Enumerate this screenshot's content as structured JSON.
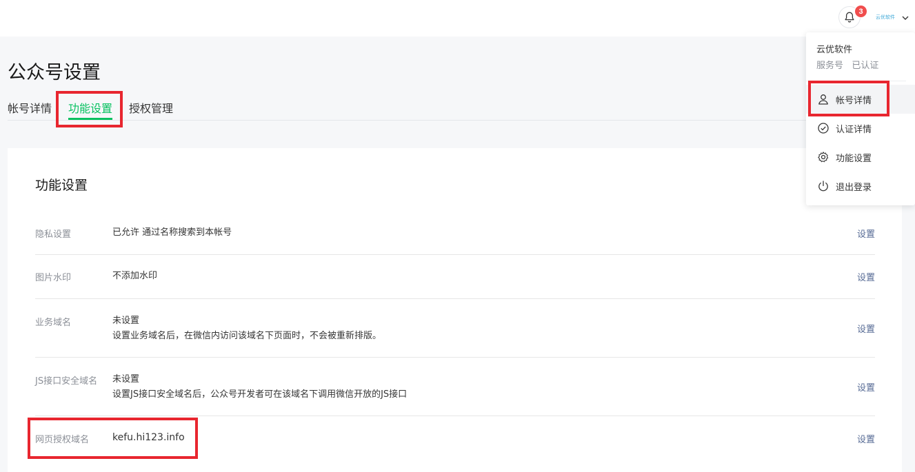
{
  "header": {
    "notification_count": "3",
    "brand_logo_text": "云优软件"
  },
  "page": {
    "title": "公众号设置",
    "tabs": [
      {
        "label": "帐号详情"
      },
      {
        "label": "功能设置"
      },
      {
        "label": "授权管理"
      }
    ]
  },
  "card": {
    "title": "功能设置",
    "rows": [
      {
        "label": "隐私设置",
        "value": "已允许 通过名称搜索到本帐号",
        "value2": "",
        "action": "设置"
      },
      {
        "label": "图片水印",
        "value": "不添加水印",
        "value2": "",
        "action": "设置"
      },
      {
        "label": "业务域名",
        "value": "未设置",
        "value2": "设置业务域名后，在微信内访问该域名下页面时，不会被重新排版。",
        "action": "设置"
      },
      {
        "label": "JS接口安全域名",
        "value": "未设置",
        "value2": "设置JS接口安全域名后，公众号开发者可在该域名下调用微信开放的JS接口",
        "action": "设置"
      },
      {
        "label": "网页授权域名",
        "value": "kefu.hi123.info",
        "value2": "",
        "action": "设置"
      }
    ]
  },
  "dropdown": {
    "account_name": "云优软件",
    "account_type": "服务号",
    "verified": "已认证",
    "items": [
      {
        "label": "帐号详情",
        "icon": "user-icon"
      },
      {
        "label": "认证详情",
        "icon": "check-circle-icon"
      },
      {
        "label": "功能设置",
        "icon": "gear-icon"
      },
      {
        "label": "退出登录",
        "icon": "power-icon"
      }
    ]
  },
  "colors": {
    "accent_green": "#07c160",
    "link_blue": "#576b95",
    "badge_red": "#f04d4d",
    "highlight_red": "#e8262f"
  }
}
